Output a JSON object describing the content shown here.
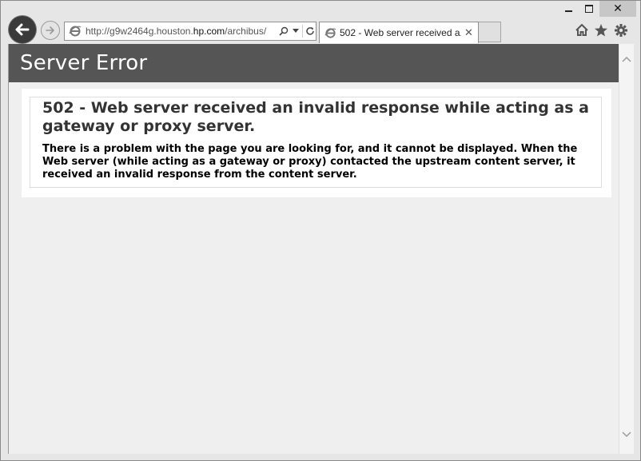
{
  "window": {
    "minimize_icon": "minimize-icon",
    "maximize_icon": "maximize-icon",
    "close_label": "✕"
  },
  "navigation": {
    "back_icon": "arrow-left-icon",
    "forward_icon": "arrow-right-icon"
  },
  "address_bar": {
    "url_prefix": "http://g9w2464g.houston.",
    "url_host": "hp.com",
    "url_suffix": "/archibus/",
    "search_icon": "search-icon",
    "dropdown_icon": "chevron-down-icon",
    "refresh_icon": "refresh-icon"
  },
  "tab": {
    "title": "502 - Web server received a...",
    "close_label": "✕"
  },
  "toolbar": {
    "home_icon": "home-icon",
    "favorites_icon": "star-icon",
    "settings_icon": "gear-icon"
  },
  "page": {
    "header_title": "Server Error",
    "error_heading": "502 - Web server received an invalid response while acting as a gateway or proxy server.",
    "error_message": "There is a problem with the page you are looking for, and it cannot be displayed. When the Web server (while acting as a gateway or proxy) contacted the upstream content server, it received an invalid response from the content server."
  },
  "colors": {
    "header_bg": "#555555",
    "page_bg": "#efefef",
    "panel_bg": "#ffffff"
  }
}
